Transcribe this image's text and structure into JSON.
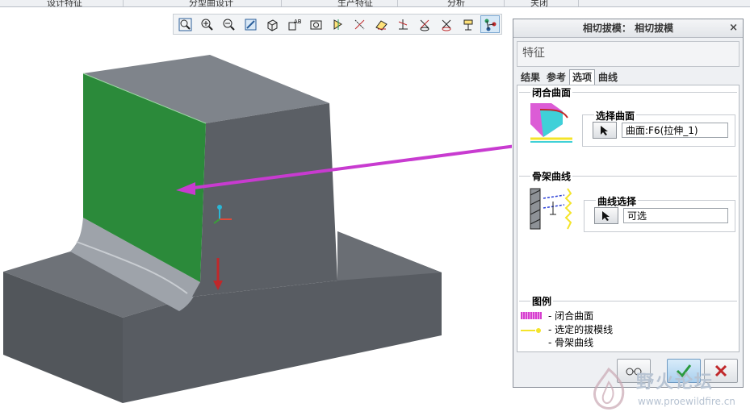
{
  "top_menu": [
    "设计特征",
    "分型曲设计",
    "生产特征",
    "分析",
    "关闭"
  ],
  "toolbar": {
    "icons": [
      "zoom-window-icon",
      "zoom-in-icon",
      "zoom-out-icon",
      "refit-icon",
      "display-style-icon",
      "view-manager-icon",
      "saved-views-icon",
      "datum-display-icon",
      "axis-display-icon",
      "point-display-icon",
      "csys-display-icon",
      "annotation-display-icon",
      "spin-center-icon",
      "plane-tag-icon",
      "tangent-draft-active-icon"
    ],
    "active_index": 14
  },
  "dialog": {
    "title": "相切拔模： 相切拔模",
    "close": "×",
    "feature_label": "特征",
    "tabs": [
      "结果",
      "参考",
      "选项",
      "曲线"
    ],
    "selected_tab": 2,
    "closed_surface_group": {
      "title": "闭合曲面",
      "select_box_label": "选择曲面",
      "field_value": "曲面:F6(拉伸_1)"
    },
    "skeleton_curve_group": {
      "title": "骨架曲线",
      "select_box_label": "曲线选择",
      "field_value": "可选"
    },
    "legend": {
      "title": "图例",
      "items": [
        {
          "text": "- 闭合曲面",
          "color": "#d63fcf"
        },
        {
          "text": "- 选定的拔模线",
          "color": "#f4e42a"
        },
        {
          "text": "- 骨架曲线",
          "color": "#ffffff"
        }
      ]
    },
    "buttons": {
      "glasses": "preview-glasses-icon",
      "ok": "check-icon",
      "cancel": "x-icon"
    }
  },
  "watermark": {
    "title": "野火论坛",
    "url": "www.proewildfire.cn"
  },
  "colors": {
    "green_face": "#2b8a3a",
    "model_gray": "#585c62",
    "arrow": "#c83bd0"
  }
}
